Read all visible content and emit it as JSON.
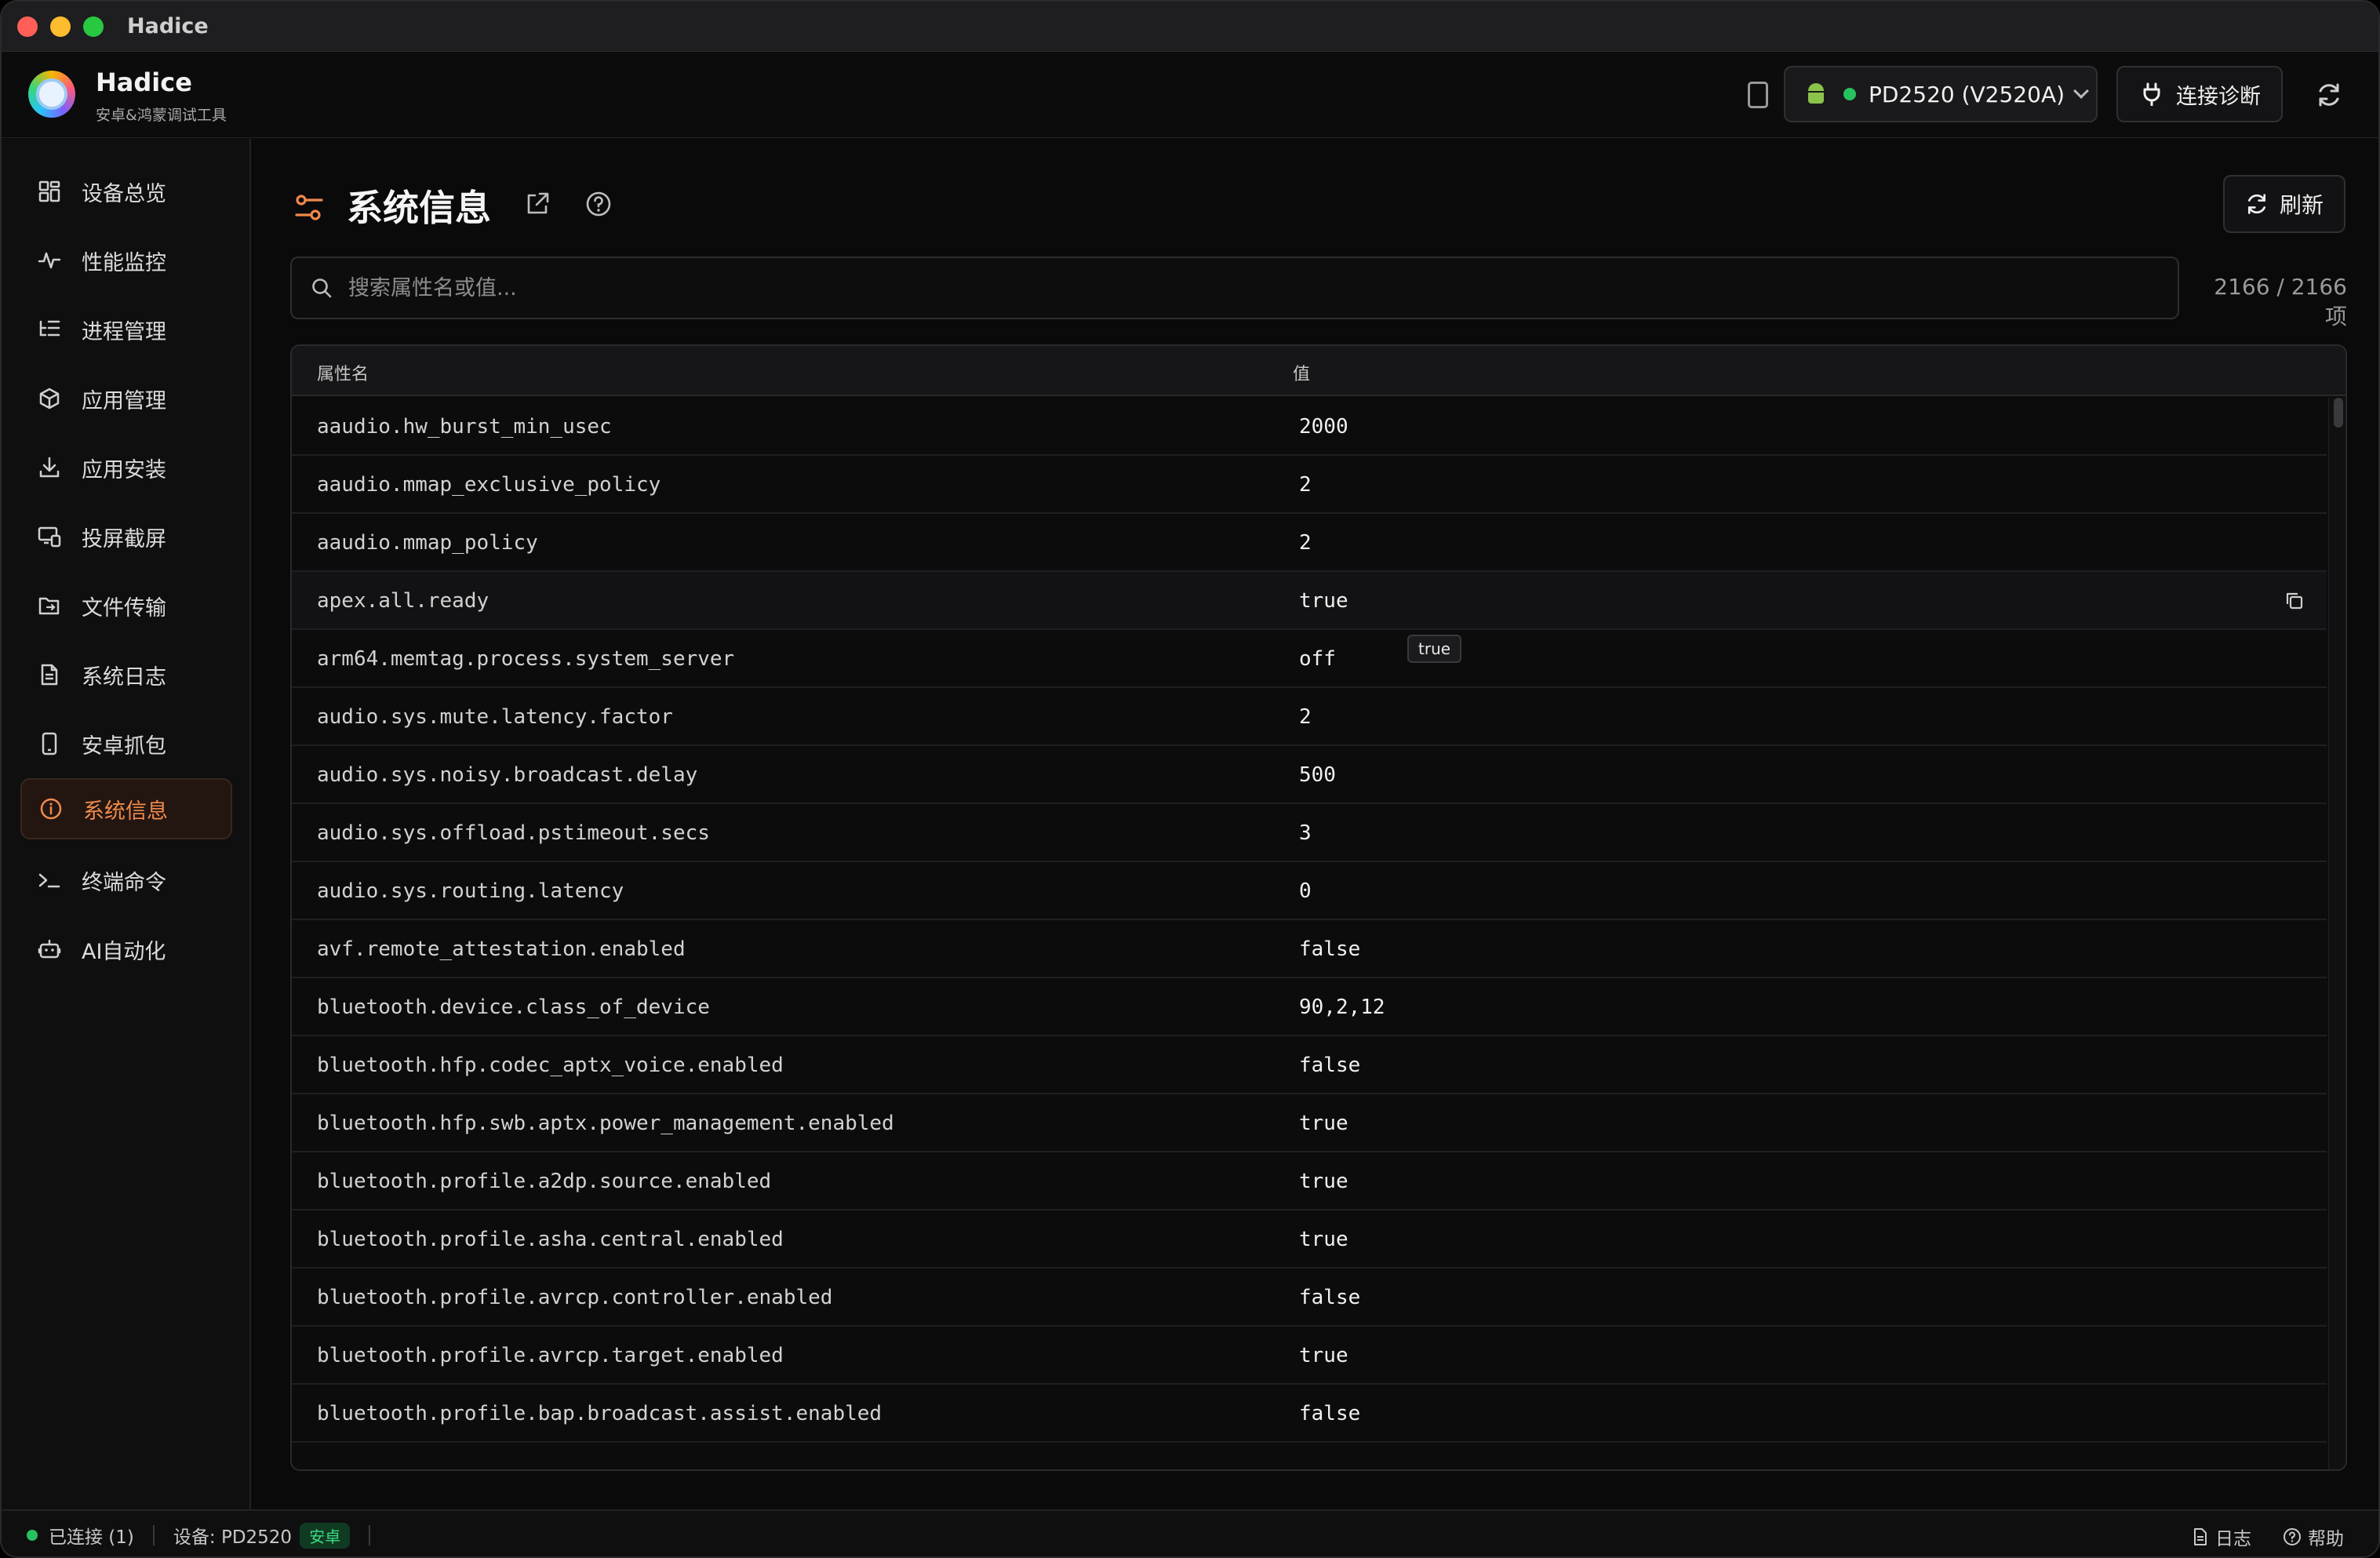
{
  "window": {
    "title": "Hadice"
  },
  "header": {
    "app_name": "Hadice",
    "app_subtitle": "安卓&鸿蒙调试工具",
    "device_label": "PD2520 (V2520A)",
    "diagnose_label": "连接诊断"
  },
  "sidebar": {
    "items": [
      {
        "label": "设备总览",
        "icon": "grid-icon"
      },
      {
        "label": "性能监控",
        "icon": "pulse-icon"
      },
      {
        "label": "进程管理",
        "icon": "list-tree-icon"
      },
      {
        "label": "应用管理",
        "icon": "package-icon"
      },
      {
        "label": "应用安装",
        "icon": "download-icon"
      },
      {
        "label": "投屏截屏",
        "icon": "cast-icon"
      },
      {
        "label": "文件传输",
        "icon": "folder-transfer-icon"
      },
      {
        "label": "系统日志",
        "icon": "document-icon"
      },
      {
        "label": "安卓抓包",
        "icon": "phone-icon"
      },
      {
        "label": "系统信息",
        "icon": "info-icon",
        "active": true
      },
      {
        "label": "终端命令",
        "icon": "terminal-icon"
      },
      {
        "label": "AI自动化",
        "icon": "robot-icon"
      }
    ]
  },
  "main": {
    "title": "系统信息",
    "refresh_label": "刷新",
    "search_placeholder": "搜索属性名或值...",
    "count": "2166 / 2166 项",
    "table": {
      "col_name": "属性名",
      "col_value": "值",
      "rows": [
        {
          "k": "aaudio.hw_burst_min_usec",
          "v": "2000"
        },
        {
          "k": "aaudio.mmap_exclusive_policy",
          "v": "2"
        },
        {
          "k": "aaudio.mmap_policy",
          "v": "2"
        },
        {
          "k": "apex.all.ready",
          "v": "true"
        },
        {
          "k": "arm64.memtag.process.system_server",
          "v": "off"
        },
        {
          "k": "audio.sys.mute.latency.factor",
          "v": "2"
        },
        {
          "k": "audio.sys.noisy.broadcast.delay",
          "v": "500"
        },
        {
          "k": "audio.sys.offload.pstimeout.secs",
          "v": "3"
        },
        {
          "k": "audio.sys.routing.latency",
          "v": "0"
        },
        {
          "k": "avf.remote_attestation.enabled",
          "v": "false"
        },
        {
          "k": "bluetooth.device.class_of_device",
          "v": "90,2,12"
        },
        {
          "k": "bluetooth.hfp.codec_aptx_voice.enabled",
          "v": "false"
        },
        {
          "k": "bluetooth.hfp.swb.aptx.power_management.enabled",
          "v": "true"
        },
        {
          "k": "bluetooth.profile.a2dp.source.enabled",
          "v": "true"
        },
        {
          "k": "bluetooth.profile.asha.central.enabled",
          "v": "true"
        },
        {
          "k": "bluetooth.profile.avrcp.controller.enabled",
          "v": "false"
        },
        {
          "k": "bluetooth.profile.avrcp.target.enabled",
          "v": "true"
        },
        {
          "k": "bluetooth.profile.bap.broadcast.assist.enabled",
          "v": "false"
        }
      ]
    },
    "tooltip": "true"
  },
  "statusbar": {
    "connected": "已连接 (1)",
    "device": "设备: PD2520",
    "platform_badge": "安卓",
    "log_label": "日志",
    "help_label": "帮助"
  },
  "colors": {
    "accent": "#f08a4b",
    "online": "#27c25f"
  }
}
